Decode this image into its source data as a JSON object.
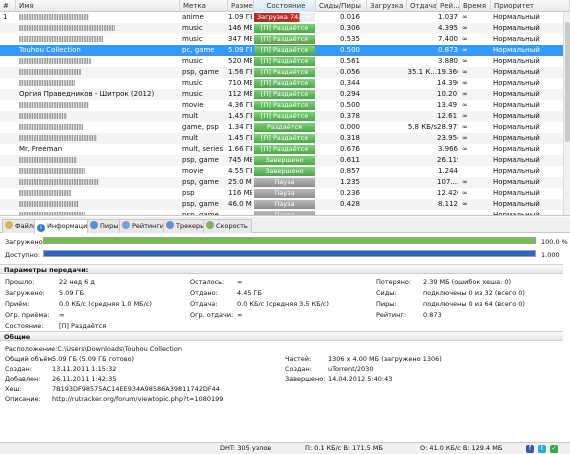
{
  "columns": [
    "#",
    "Имя",
    "Метка",
    "Размер",
    "Состояние",
    "Сиды/Пиры",
    "Загрузка",
    "Отдача",
    "Рей...",
    "Время",
    "Приоритет"
  ],
  "rows": [
    {
      "num": "1",
      "name": "",
      "label": "anime",
      "size": "1.09 ГБ",
      "status": "Загрузка 74.3%",
      "status_kind": "dl",
      "progress": 0.743,
      "seeds": "0.016",
      "down": "",
      "up": "",
      "ratio": "1.037",
      "time": "∞",
      "priority": "Нормальный"
    },
    {
      "num": "",
      "name": "",
      "label": "music",
      "size": "146 МБ",
      "status": "[П] Раздаётся",
      "status_kind": "seed",
      "progress": 1,
      "seeds": "0.306",
      "down": "",
      "up": "",
      "ratio": "4.395",
      "time": "∞",
      "priority": "Нормальный"
    },
    {
      "num": "",
      "name": "",
      "label": "music",
      "size": "347 МБ",
      "status": "[П] Раздаётся",
      "status_kind": "seed",
      "progress": 1,
      "seeds": "0.535",
      "down": "",
      "up": "",
      "ratio": "7.400",
      "time": "∞",
      "priority": "Нормальный"
    },
    {
      "num": "",
      "name": "Touhou Collection",
      "label": "pc, game",
      "size": "5.09 ГБ",
      "status": "[П] Раздаётся",
      "status_kind": "seed",
      "progress": 1,
      "seeds": "0.500",
      "down": "",
      "up": "",
      "ratio": "0.873",
      "time": "∞",
      "priority": "Нормальный"
    },
    {
      "num": "",
      "name": "",
      "label": "music",
      "size": "520 МБ",
      "status": "[П] Раздаётся",
      "status_kind": "seed",
      "progress": 1,
      "seeds": "0.561",
      "down": "",
      "up": "",
      "ratio": "3.880",
      "time": "∞",
      "priority": "Нормальный"
    },
    {
      "num": "",
      "name": "",
      "label": "psp, game",
      "size": "1.56 ГБ",
      "status": "[П] Раздаётся",
      "status_kind": "seed",
      "progress": 1,
      "seeds": "0.056",
      "down": "",
      "up": "35.1 К...",
      "ratio": "19.366",
      "time": "∞",
      "priority": "Нормальный"
    },
    {
      "num": "",
      "name": "",
      "label": "music",
      "size": "710 МБ",
      "status": "[П] Раздаётся",
      "status_kind": "seed",
      "progress": 1,
      "seeds": "0.344",
      "down": "",
      "up": "",
      "ratio": "14.390",
      "time": "∞",
      "priority": "Нормальный"
    },
    {
      "num": "",
      "name": "Оргия Праведников - Шитрок (2012)",
      "label": "music",
      "size": "112 МБ",
      "status": "[П] Раздаётся",
      "status_kind": "seed",
      "progress": 1,
      "seeds": "0.294",
      "down": "",
      "up": "",
      "ratio": "10.201",
      "time": "∞",
      "priority": "Нормальный"
    },
    {
      "num": "",
      "name": "",
      "label": "movie",
      "size": "4.36 ГБ",
      "status": "[П] Раздаётся",
      "status_kind": "seed",
      "progress": 1,
      "seeds": "0.500",
      "down": "",
      "up": "",
      "ratio": "13.491",
      "time": "∞",
      "priority": "Нормальный"
    },
    {
      "num": "",
      "name": "",
      "label": "mult",
      "size": "1.45 ГБ",
      "status": "[П] Раздаётся",
      "status_kind": "seed",
      "progress": 1,
      "seeds": "0.378",
      "down": "",
      "up": "",
      "ratio": "12.611",
      "time": "∞",
      "priority": "Нормальный"
    },
    {
      "num": "",
      "name": "",
      "label": "game, psp",
      "size": "1.34 ГБ",
      "status": "Раздаётся",
      "status_kind": "seed",
      "progress": 1,
      "seeds": "0.000",
      "down": "",
      "up": "5.8 КБ/s",
      "ratio": "28.975",
      "time": "∞",
      "priority": "Нормальный"
    },
    {
      "num": "",
      "name": "",
      "label": "mult",
      "size": "1.45 ГБ",
      "status": "[П] Раздаётся",
      "status_kind": "seed",
      "progress": 1,
      "seeds": "0.318",
      "down": "",
      "up": "",
      "ratio": "23.954",
      "time": "∞",
      "priority": "Нормальный"
    },
    {
      "num": "",
      "name": "Mr. Freeman",
      "label": "mult, series",
      "size": "1.66 ГБ",
      "status": "[П] Раздаётся",
      "status_kind": "seed",
      "progress": 1,
      "seeds": "0.676",
      "down": "",
      "up": "",
      "ratio": "3.966",
      "time": "∞",
      "priority": "Нормальный"
    },
    {
      "num": "",
      "name": "",
      "label": "psp, game",
      "size": "745 МБ",
      "status": "Завершено",
      "status_kind": "done",
      "progress": 1,
      "seeds": "0.611",
      "down": "",
      "up": "",
      "ratio": "26.119",
      "time": "",
      "priority": "Нормальный"
    },
    {
      "num": "",
      "name": "",
      "label": "movie",
      "size": "4.55 ГБ",
      "status": "Завершено",
      "status_kind": "done",
      "progress": 1,
      "seeds": "0.857",
      "down": "",
      "up": "",
      "ratio": "1.244",
      "time": "",
      "priority": "Нормальный"
    },
    {
      "num": "",
      "name": "",
      "label": "psp, game",
      "size": "25.0 МБ",
      "status": "Пауза",
      "status_kind": "pause",
      "progress": 1,
      "seeds": "1.235",
      "down": "",
      "up": "",
      "ratio": "107....",
      "time": "∞",
      "priority": "Нормальный"
    },
    {
      "num": "",
      "name": "",
      "label": "psp",
      "size": "116 МБ",
      "status": "Пауза",
      "status_kind": "pause",
      "progress": 1,
      "seeds": "0.236",
      "down": "",
      "up": "",
      "ratio": "12.420",
      "time": "∞",
      "priority": "Нормальный"
    },
    {
      "num": "",
      "name": "",
      "label": "psp, game",
      "size": "46.0 МБ",
      "status": "Пауза",
      "status_kind": "pause",
      "progress": 1,
      "seeds": "0.428",
      "down": "",
      "up": "",
      "ratio": "8.112",
      "time": "∞",
      "priority": "Нормальный"
    },
    {
      "num": "",
      "name": "",
      "label": "psp, game",
      "size": "",
      "status": "Пауза",
      "status_kind": "pause",
      "progress": 1,
      "seeds": "",
      "down": "",
      "up": "",
      "ratio": "",
      "time": "",
      "priority": "Нормальный"
    }
  ],
  "tabs": [
    {
      "label": "Файлы",
      "icon": "files-icon"
    },
    {
      "label": "Информация",
      "icon": "info-icon"
    },
    {
      "label": "Пиры",
      "icon": "peers-icon"
    },
    {
      "label": "Рейтинги",
      "icon": "ratings-icon"
    },
    {
      "label": "Трекеры",
      "icon": "trackers-icon"
    },
    {
      "label": "Скорость",
      "icon": "speed-icon"
    }
  ],
  "downloaded": {
    "label": "Загружено:",
    "value": "100.0 %",
    "fraction": 1.0
  },
  "available": {
    "label": "Доступно:",
    "value": "1.000",
    "fraction": 1.0
  },
  "transfer": {
    "title": "Параметры передачи:",
    "col1": [
      {
        "k": "Прошло:",
        "v": "22 нед 6 д"
      },
      {
        "k": "Загружено:",
        "v": "5.09 ГБ"
      },
      {
        "k": "Приём:",
        "v": "0.0 КБ/с (средняя 1.0 МБ/с)"
      },
      {
        "k": "Огр. приёма:",
        "v": "∞"
      },
      {
        "k": "Состояние:",
        "v": "[П] Раздаётся"
      }
    ],
    "col2": [
      {
        "k": "Осталось:",
        "v": "∞"
      },
      {
        "k": "Отдано:",
        "v": "4.45 ГБ"
      },
      {
        "k": "Отдача:",
        "v": "0.0 КБ/с (средняя 3.5 КБ/с)"
      },
      {
        "k": "Огр. отдачи:",
        "v": "∞"
      }
    ],
    "col3": [
      {
        "k": "Потеряно:",
        "v": "2.39 МБ (ошибок хеша: 0)"
      },
      {
        "k": "Сиды:",
        "v": "подключены 0 из 32 (всего 0)"
      },
      {
        "k": "Пиры:",
        "v": "подключены 0 из 64 (всего 0)"
      },
      {
        "k": "Рейтинг:",
        "v": "0.873"
      }
    ]
  },
  "general": {
    "title": "Общие",
    "path": "Расположение:C:\\Users\\Downloads\\Touhou Collection",
    "left": [
      {
        "k": "Общий объём:",
        "v": "5.09 ГБ (5.09 ГБ готово)"
      },
      {
        "k": "Создан:",
        "v": "13.11.2011 1:15:32"
      },
      {
        "k": "Добавлен:",
        "v": "26.11.2011 1:42:35"
      },
      {
        "k": "Хеш:",
        "v": "7B193DF98575AC14EE934A98586A39811742DF44"
      },
      {
        "k": "Описание:",
        "v": "http://rutracker.org/forum/viewtopic.php?t=1080199"
      }
    ],
    "right": [
      {
        "k": "Частей:",
        "v": "1306 x 4.00 МБ (загружено 1306)"
      },
      {
        "k": "Создан:",
        "v": "uTorrent/2030"
      },
      {
        "k": "Завершено:",
        "v": "14.04.2012 5:40:43"
      }
    ]
  },
  "statusbar": {
    "dht": "DHT: 305 узлов",
    "download": "П: 0.1 КБ/с В: 171.5 МБ",
    "upload": "О: 41.0 КБ/с В: 129.4 МБ"
  },
  "colors": {
    "selected": "#3399ff",
    "seeding": "#4aa845",
    "paused": "#8e8e8e",
    "downloading": "#b22a26",
    "available": "#2f62c8"
  }
}
